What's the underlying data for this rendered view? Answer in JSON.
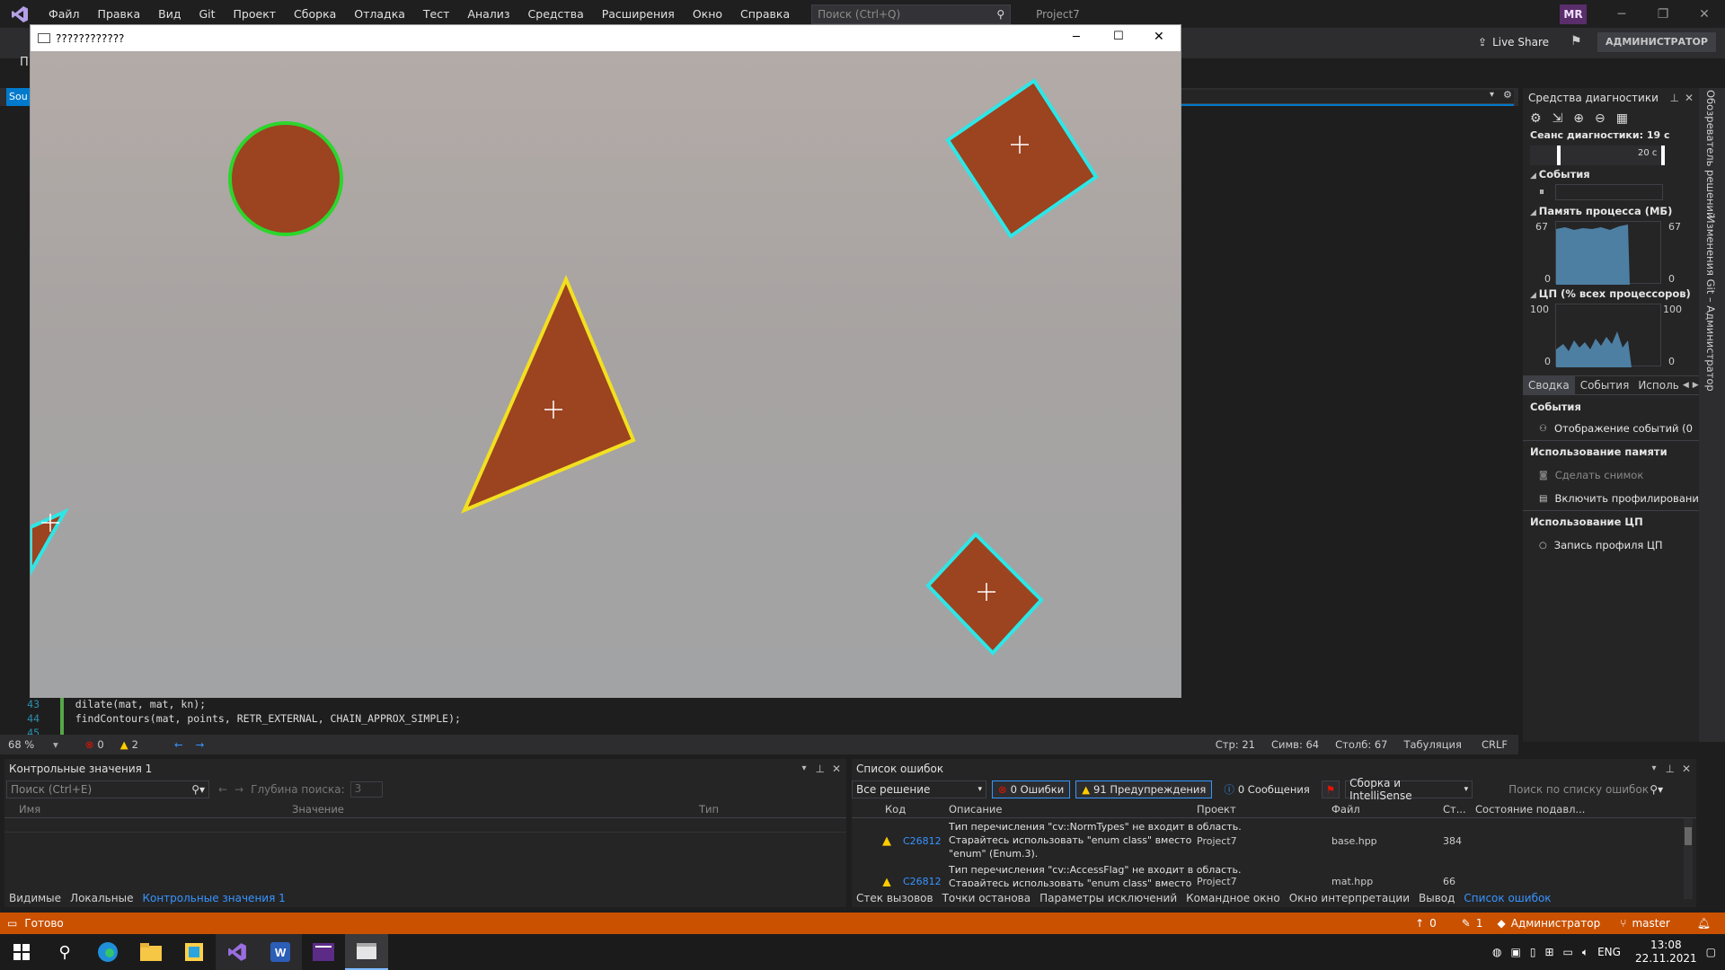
{
  "menu": {
    "items": [
      "Файл",
      "Правка",
      "Вид",
      "Git",
      "Проект",
      "Сборка",
      "Отладка",
      "Тест",
      "Анализ",
      "Средства",
      "Расширения",
      "Окно",
      "Справка"
    ],
    "search_placeholder": "Поиск (Ctrl+Q)",
    "project": "Project7",
    "avatar": "MR"
  },
  "toolbar": {
    "live_share": "Live Share",
    "admin_badge": "АДМИНИСТРАТОР",
    "left_text": "П"
  },
  "editor": {
    "tab_label": "Sou",
    "lines": [
      {
        "n": "43",
        "code": "    dilate(mat, mat, kn);"
      },
      {
        "n": "44",
        "code": "    findContours(mat, points, RETR_EXTERNAL, CHAIN_APPROX_SIMPLE);"
      },
      {
        "n": "45",
        "code": ""
      }
    ],
    "status": {
      "zoom": "68 %",
      "errors": "0",
      "warnings": "2",
      "line": "Стр: 21",
      "char": "Симв: 64",
      "col": "Столб: 67",
      "indent": "Табуляция",
      "eol": "CRLF"
    }
  },
  "cv_window": {
    "title": "????????????"
  },
  "diagnostics": {
    "title": "Средства диагностики",
    "session": "Сеанс диагностики: 19 с",
    "timeline_label": "20 с",
    "events_header": "События",
    "memory_header": "Память процесса (МБ)",
    "memory_max": "67",
    "memory_min": "0",
    "cpu_header": "ЦП (% всех процессоров)",
    "cpu_max": "100",
    "cpu_min": "0",
    "tabs": [
      "Сводка",
      "События",
      "Исполь"
    ],
    "sections": [
      {
        "title": "События",
        "items": [
          "Отображение событий (0"
        ]
      },
      {
        "title": "Использование памяти",
        "items": [
          "Сделать снимок",
          "Включить профилировани"
        ]
      },
      {
        "title": "Использование ЦП",
        "items": [
          "Запись профиля ЦП"
        ]
      }
    ]
  },
  "side_tabs": [
    "Обозреватель решений",
    "Изменения Git – Администратор"
  ],
  "watch": {
    "title": "Контрольные значения 1",
    "search_placeholder": "Поиск (Ctrl+E)",
    "depth_label": "Глубина поиска:",
    "depth_value": "3",
    "columns": [
      "Имя",
      "Значение",
      "Тип"
    ],
    "bottom_tabs": [
      "Видимые",
      "Локальные",
      "Контрольные значения 1"
    ]
  },
  "errors": {
    "title": "Список ошибок",
    "scope": "Все решение",
    "errors_btn": "0 Ошибки",
    "warnings_btn": "91 Предупреждения",
    "messages_btn": "0 Сообщения",
    "build_filter": "Сборка и IntelliSense",
    "search_placeholder": "Поиск по списку ошибок",
    "columns": [
      "Код",
      "Описание",
      "Проект",
      "Файл",
      "Ст...",
      "Состояние подавл..."
    ],
    "rows": [
      {
        "code": "C26812",
        "desc": [
          "Тип перечисления \"cv::NormTypes\" не входит в область.",
          "Старайтесь использовать \"enum class\" вместо",
          "\"enum\" (Enum.3)."
        ],
        "project": "Project7",
        "file": "base.hpp",
        "line": "384"
      },
      {
        "code": "C26812",
        "desc": [
          "Тип перечисления \"cv::AccessFlag\" не входит в область.",
          "Старайтесь использовать \"enum class\" вместо"
        ],
        "project": "Project7",
        "file": "mat.hpp",
        "line": "66"
      }
    ],
    "bottom_tabs": [
      "Стек вызовов",
      "Точки останова",
      "Параметры исключений",
      "Командное окно",
      "Окно интерпретации",
      "Вывод",
      "Список ошибок"
    ]
  },
  "statusbar": {
    "ready": "Готово",
    "push": "0",
    "edits": "1",
    "user": "Администратор",
    "branch": "master"
  },
  "taskbar": {
    "lang": "ENG",
    "time": "13:08",
    "date": "22.11.2021"
  }
}
